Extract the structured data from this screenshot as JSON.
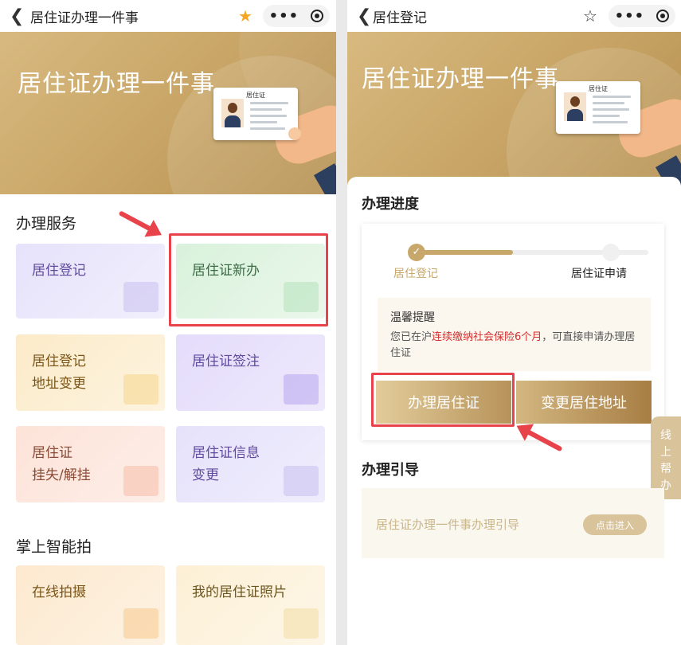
{
  "left": {
    "nav": {
      "back_icon": "chevron-left-icon",
      "title": "居住证办理一件事",
      "star_icon": "star-filled-icon",
      "star_color": "#f5a623",
      "more_icon": "more-dots-icon",
      "close_icon": "target-icon"
    },
    "banner": {
      "title": "居住证办理一件事",
      "card_label": "居住证"
    },
    "services": {
      "title": "办理服务",
      "tiles": [
        {
          "label": "居住登记",
          "icon": "document-user-icon"
        },
        {
          "label": "居住证新办",
          "icon": "id-card-icon"
        },
        {
          "label": "居住登记\n地址变更",
          "icon": "refresh-document-icon"
        },
        {
          "label": "居住证签注",
          "icon": "edit-icon"
        },
        {
          "label": "居住证\n挂失/解挂",
          "icon": "card-ban-icon"
        },
        {
          "label": "居住证信息\n变更",
          "icon": "card-refresh-icon"
        }
      ]
    },
    "smart": {
      "title": "掌上智能拍",
      "tiles": [
        {
          "label": "在线拍摄",
          "icon": "camera-icon"
        },
        {
          "label": "我的居住证照片",
          "icon": "photo-icon"
        }
      ]
    }
  },
  "right": {
    "nav": {
      "back_icon": "chevron-left-icon",
      "title": "居住登记",
      "star_icon": "star-outline-icon",
      "more_icon": "more-dots-icon",
      "close_icon": "target-icon"
    },
    "banner": {
      "title": "居住证办理一件事",
      "card_label": "居住证"
    },
    "progress": {
      "title": "办理进度",
      "step1": "居住登记",
      "step2": "居住证申请",
      "check_icon": "check-icon",
      "notice_title": "温馨提醒",
      "notice_pre": "您已在沪",
      "notice_highlight": "连续缴纳社会保险6个月",
      "notice_post": "，可直接申请办理居住证",
      "highlight_color": "#d42e2e",
      "btn_apply": "办理居住证",
      "btn_change": "变更居住地址"
    },
    "help_tab": "线上帮办",
    "guide": {
      "title": "办理引导",
      "item": "居住证办理一件事办理引导",
      "enter": "点击进入"
    }
  },
  "annotation_color": "#e8434a"
}
